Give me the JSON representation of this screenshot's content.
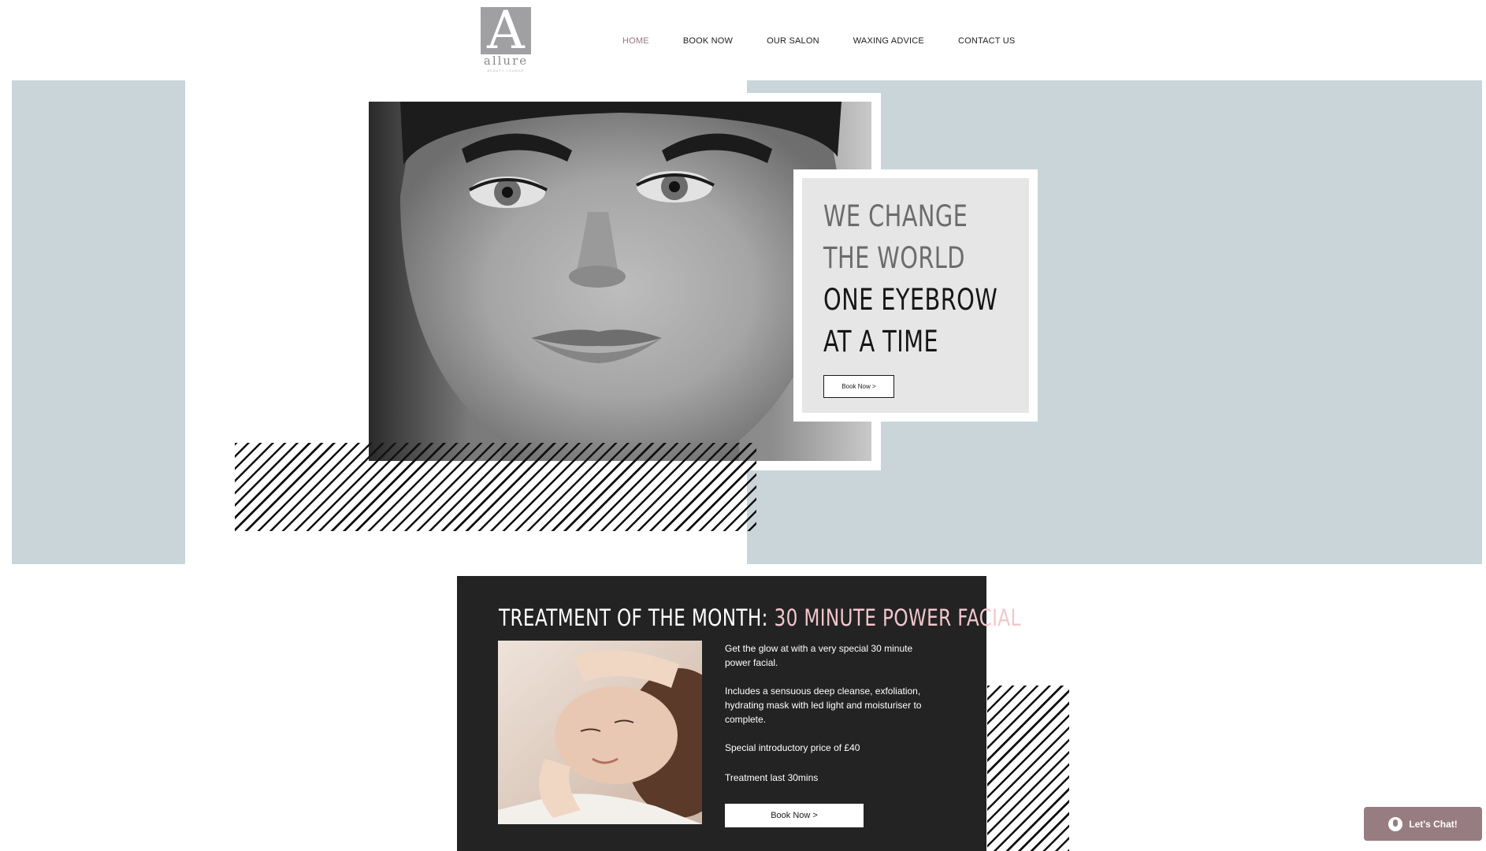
{
  "brand": {
    "logo_letter": "A",
    "logo_word": "allure",
    "logo_tagline": "BEAUTY LOUNGE"
  },
  "nav": {
    "items": [
      {
        "label": "HOME",
        "active": true
      },
      {
        "label": "BOOK NOW",
        "active": false
      },
      {
        "label": "OUR SALON",
        "active": false
      },
      {
        "label": "WAXING ADVICE",
        "active": false
      },
      {
        "label": "CONTACT US",
        "active": false
      }
    ]
  },
  "hero": {
    "headline_lines": [
      "WE CHANGE",
      "THE WORLD",
      "ONE EYEBROW",
      "AT A TIME"
    ],
    "button_label": "Book Now >"
  },
  "promo": {
    "title_lead": "TREATMENT OF THE MONTH: ",
    "title_accent": "30 MINUTE POWER FACIAL",
    "paragraphs": [
      "Get the glow at with a very special 30 minute power facial.",
      "Includes a sensuous deep cleanse, exfoliation, hydrating mask with led light and moisturiser to complete.",
      "Special introductory price of £40",
      "Treatment last 30mins"
    ],
    "button_label": "Book Now >"
  },
  "chat": {
    "label": "Let's Chat!",
    "icon": "microphone-icon"
  },
  "colors": {
    "accent": "#977d81",
    "nav_active": "#96787c",
    "hero_panel": "#c9d5d9",
    "promo_bg": "#232323",
    "promo_accent": "#f2c6cd",
    "card_bg": "#e7e6e7"
  }
}
